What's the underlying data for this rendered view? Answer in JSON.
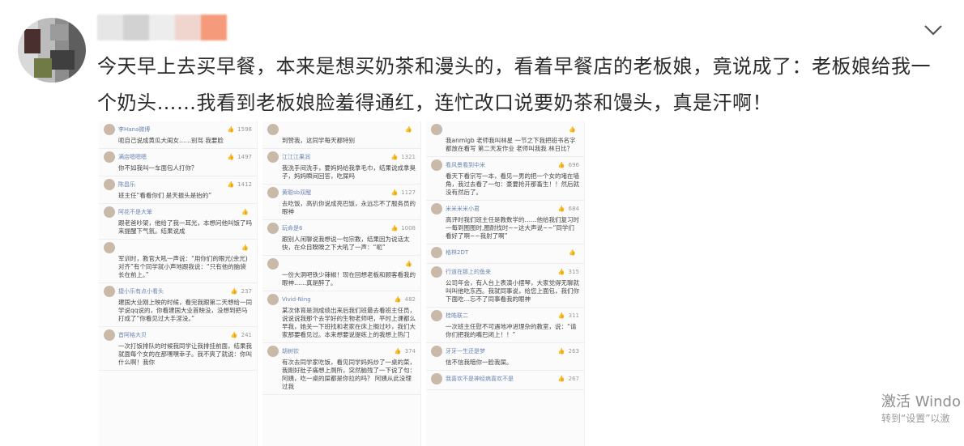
{
  "post": {
    "text": "今天早上去买早餐，本来是想买奶茶和漫头的，看着早餐店的老板娘，竟说成了：老板娘给我一个奶头……我看到老板娘脸羞得通红，连忙改口说要奶茶和馒头，真是汗啊！"
  },
  "icons": {
    "menu": "chevron-down-icon",
    "like": "thumb-up-icon"
  },
  "screenshot_columns": [
    {
      "comments": [
        {
          "name": "李Hana微博",
          "likes": "1598",
          "text": "呃自己说成黄瓜大闺女……别骂 我要脸"
        },
        {
          "name": "满店嗯嗯嗯",
          "likes": "1497",
          "text": "你不如我叫一车面包人打你？"
        },
        {
          "name": "陈昌乐",
          "likes": "1412",
          "text": "班主任“看看你们 是天振头是抬的”"
        },
        {
          "name": "阿花不是大笨",
          "likes": "",
          "text": "跟老爸吵架，他给了我一耳光，本想问他叫饭了吗来提醒下气氛。结果说成"
        },
        {
          "name": "",
          "likes": "",
          "text": "军训时，教官大吼一声说：“用你们的眼光(余光)对齐”有个同学就小声地跟我说：“只有他的脑袋长在前上。”"
        },
        {
          "name": "捷小乐有点小看头",
          "likes": "237",
          "text": "建国大业刚上映的时候，看完我跟第二天想给一同学说qq说的，你看建国大业首映没，没想到把马打成了“你看见过大手淫没。”"
        },
        {
          "name": "首阿格大贝",
          "likes": "241",
          "text": "一次打饭排队的时候我同学让我排挂前面，结果我就面每个女的在那嘿嘿幸子。我不爽了就说：你叫什么啊！我你"
        }
      ]
    },
    {
      "comments": [
        {
          "name": "",
          "likes": "",
          "text": "到赞我，这同学每天都特别"
        },
        {
          "name": "江江江果润",
          "likes": "1321",
          "text": "我洗手间洗手，要妈妈给我拿毛巾，结果说成拿臭子，妈妈瞬间回答，吃屎吗"
        },
        {
          "name": "黄聪sb双醒",
          "likes": "1127",
          "text": "去吃饭，高扒你说成亮巴饭，永远忘不了服务员的眼神"
        },
        {
          "name": "玩命是6",
          "likes": "1008",
          "text": "跟别人闲聊说我想说一句宗教，结果因为说话太快，在众目睽睽之下大吼了一声：“呃”"
        },
        {
          "name": "",
          "likes": "",
          "text": "一份大洞吧铁少辣椒！现在回想老板和顾客看我的眼神……真是醉了。"
        },
        {
          "name": "Vivid-Ning",
          "likes": "482",
          "text": "某次体育是测成绩出来后我们班最去看班主任员，说说说我那个去学好的生物老师吧，平时上课都么早我，她关一下班找和老家在床上搁过吵，我们大家那要看见过。本来想要说提练上的我想上热门"
        },
        {
          "name": "胡树钦",
          "likes": "374",
          "text": "有次去同学家吃饭，看见同学妈妈炒了一桌的菜，我刚好肚子痛想上厕所，突然脑残了一下说了句：阿姨，吃一桌的屎都是你拉的吗？ 阿姨从此没理过我"
        }
      ]
    },
    {
      "comments": [
        {
          "name": "",
          "likes": "",
          "text": "我anmlgb 老师我叫林星 一节之下我把班书名字都放在看写 第二天发作业 老师叫我我 林日比？"
        },
        {
          "name": "看风景看到中米",
          "likes": "696",
          "text": "看天下看宗写一本，看见一男的把一个女的堵在墙角，我过去看了一句：豪要抢开那畜生！！然后就没有然后了。"
        },
        {
          "name": "米米米米小君",
          "likes": "684",
          "text": "高评时我们班主任是教数学的……他给我们复习时一每到图图时,圈耐找时~~这大声说~~“同学们看好了啊~~我射了啊”"
        },
        {
          "name": "格林2DT",
          "likes": "",
          "text": ""
        },
        {
          "name": "行道在那上的鱼来",
          "likes": "315",
          "text": "公司年会，有人台上表演小摆琴，大家觉得无聊就叫叫他吃东西。我就同事说，给您上面包，我们你下面吃…忘不了同事看我的眼神"
        },
        {
          "name": "桂皓联二",
          "likes": "311",
          "text": "一次班主任慰不可遇地冲进理杂的教室，说：“请你们把我的嘴巴闭上！！”"
        },
        {
          "name": "牙牙一生还是梦",
          "likes": "263",
          "text": "信不信我暗你一脸我屎。"
        },
        {
          "name": "我喜欢不是神经病喜欢不是",
          "likes": "267",
          "text": ""
        }
      ]
    }
  ],
  "watermark": {
    "line1": "激活 Windo",
    "line2": "转到“设置”以激"
  }
}
